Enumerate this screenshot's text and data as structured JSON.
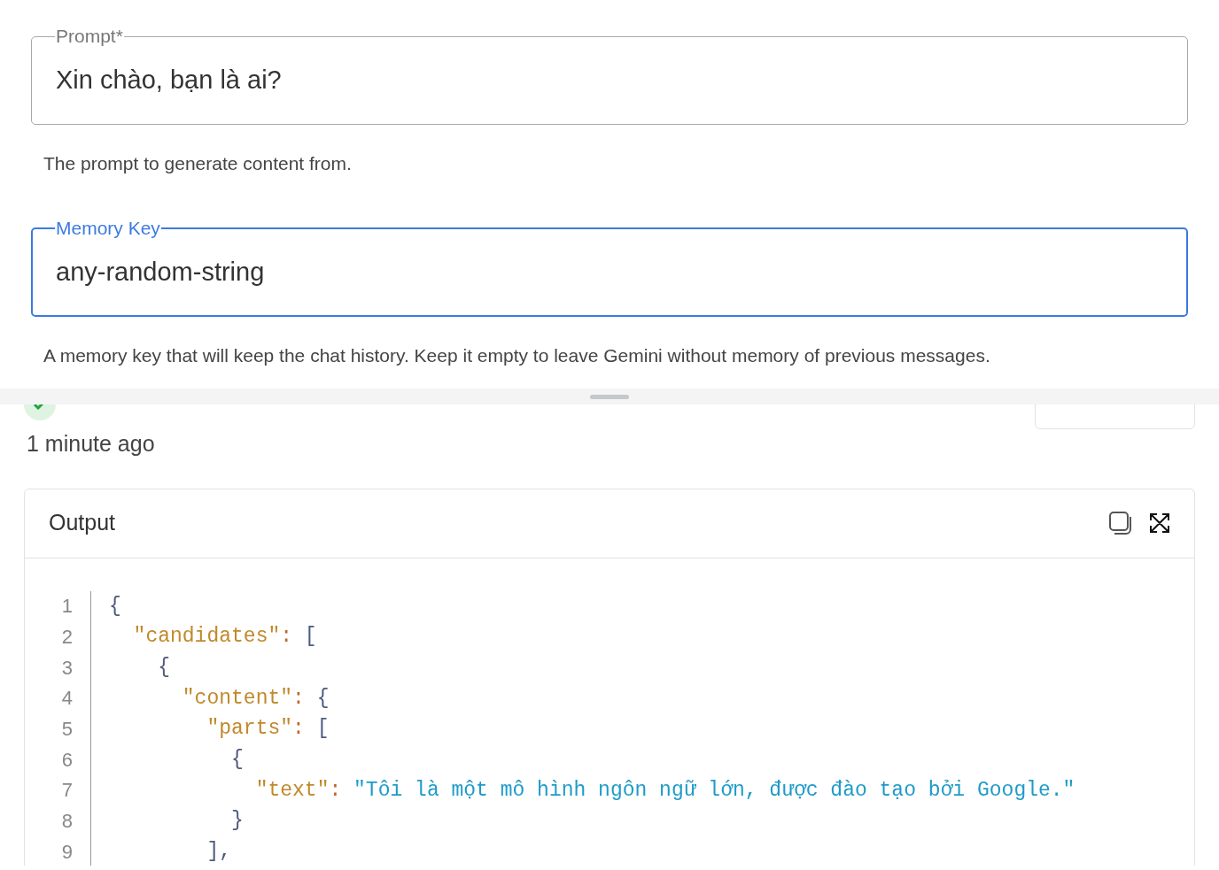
{
  "fields": [
    {
      "label": "Prompt*",
      "value": "Xin chào, bạn là ai?",
      "focused": false,
      "helper": "The prompt to generate content from."
    },
    {
      "label": "Memory Key",
      "value": "any-random-string",
      "focused": true,
      "helper": "A memory key that will keep the chat history. Keep it empty to leave Gemini without memory of previous messages."
    }
  ],
  "result": {
    "time": "1 minute ago"
  },
  "output": {
    "title": "Output",
    "lines": [
      {
        "number": "1",
        "tokens": [
          {
            "kind": "punct",
            "text": "{"
          }
        ]
      },
      {
        "number": "2",
        "tokens": [
          {
            "kind": "key",
            "text": "  \"candidates\""
          },
          {
            "kind": "colon",
            "text": ": "
          },
          {
            "kind": "punct",
            "text": "["
          }
        ]
      },
      {
        "number": "3",
        "tokens": [
          {
            "kind": "punct",
            "text": "    {"
          }
        ]
      },
      {
        "number": "4",
        "tokens": [
          {
            "kind": "key",
            "text": "      \"content\""
          },
          {
            "kind": "colon",
            "text": ": "
          },
          {
            "kind": "punct",
            "text": "{"
          }
        ]
      },
      {
        "number": "5",
        "tokens": [
          {
            "kind": "key",
            "text": "        \"parts\""
          },
          {
            "kind": "colon",
            "text": ": "
          },
          {
            "kind": "punct",
            "text": "["
          }
        ]
      },
      {
        "number": "6",
        "tokens": [
          {
            "kind": "punct",
            "text": "          {"
          }
        ]
      },
      {
        "number": "7",
        "tokens": [
          {
            "kind": "key",
            "text": "            \"text\""
          },
          {
            "kind": "colon",
            "text": ": "
          },
          {
            "kind": "string",
            "text": "\"Tôi là một mô hình ngôn ngữ lớn, được đào tạo bởi Google.\""
          }
        ]
      },
      {
        "number": "8",
        "tokens": [
          {
            "kind": "punct",
            "text": "          }"
          }
        ]
      },
      {
        "number": "9",
        "tokens": [
          {
            "kind": "punct",
            "text": "        ],"
          }
        ]
      }
    ]
  }
}
